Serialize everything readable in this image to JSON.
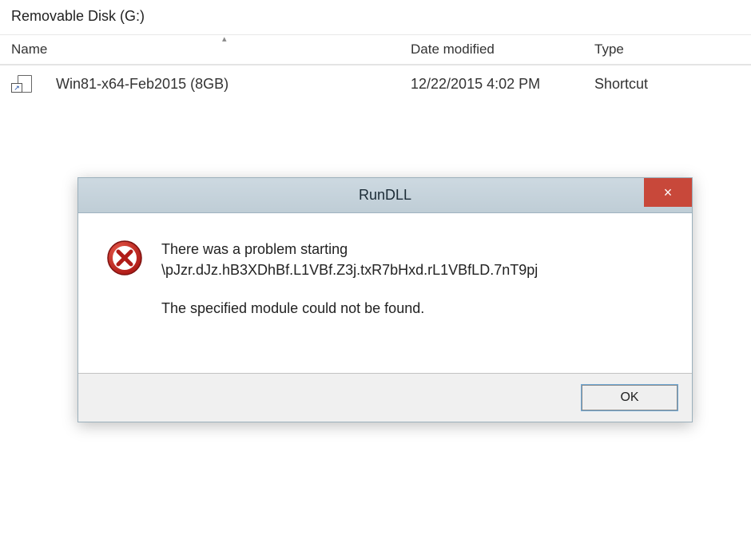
{
  "breadcrumb": {
    "location": "Removable Disk (G:)"
  },
  "columns": {
    "name": "Name",
    "date": "Date modified",
    "type": "Type"
  },
  "file": {
    "name": "Win81-x64-Feb2015 (8GB)",
    "date": "12/22/2015 4:02 PM",
    "type": "Shortcut"
  },
  "dialog": {
    "title": "RunDLL",
    "line1": "There was a problem starting",
    "path": "\\pJzr.dJz.hB3XDhBf.L1VBf.Z3j.txR7bHxd.rL1VBfLD.7nT9pj",
    "line2": "The specified module could not be found.",
    "ok": "OK",
    "close": "×"
  }
}
